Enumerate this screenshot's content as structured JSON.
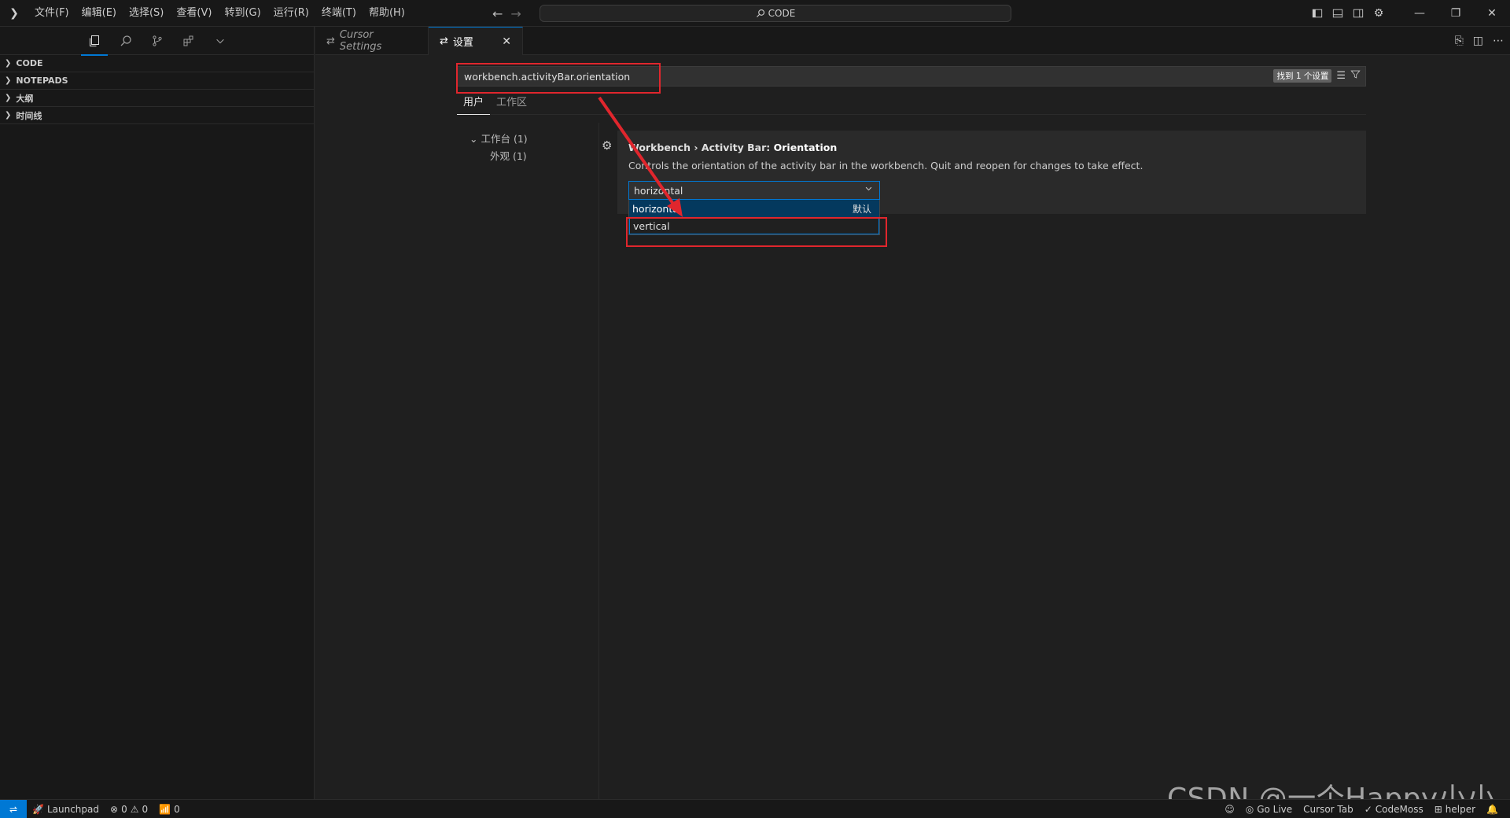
{
  "titlebar": {
    "menu": [
      "文件(F)",
      "编辑(E)",
      "选择(S)",
      "查看(V)",
      "转到(G)",
      "运行(R)",
      "终端(T)",
      "帮助(H)"
    ],
    "command_center": "CODE",
    "back_icon": "←",
    "forward_icon": "→"
  },
  "sidebar": {
    "sections": [
      "CODE",
      "NOTEPADS",
      "大纲",
      "时间线"
    ]
  },
  "tabs": [
    {
      "label": "Cursor Settings"
    },
    {
      "label": "设置",
      "close": "✕"
    }
  ],
  "settings": {
    "search_value": "workbench.activityBar.orientation",
    "found_badge": "找到 1 个设置",
    "scope_tabs": [
      "用户",
      "工作区"
    ],
    "toc": {
      "parent": "工作台 (1)",
      "child": "外观 (1)"
    },
    "setting": {
      "prefix": "Workbench › Activity Bar: ",
      "key": "Orientation",
      "description": "Controls the orientation of the activity bar in the workbench. Quit and reopen for changes to take effect.",
      "current_value": "horizontal",
      "options": [
        {
          "label": "horizontal",
          "desc": "默认"
        },
        {
          "label": "vertical",
          "desc": ""
        }
      ]
    }
  },
  "statusbar": {
    "launchpad": "Launchpad",
    "errors": "0",
    "warnings": "0",
    "ports": "0",
    "right_items": [
      "Go Live",
      "Cursor Tab",
      "CodeMoss",
      "helper"
    ]
  },
  "watermark": "CSDN @一个Happy小小猪",
  "colors": {
    "accent": "#0078d4",
    "annotation_red": "#e0262d",
    "background": "#1f1f1f"
  }
}
